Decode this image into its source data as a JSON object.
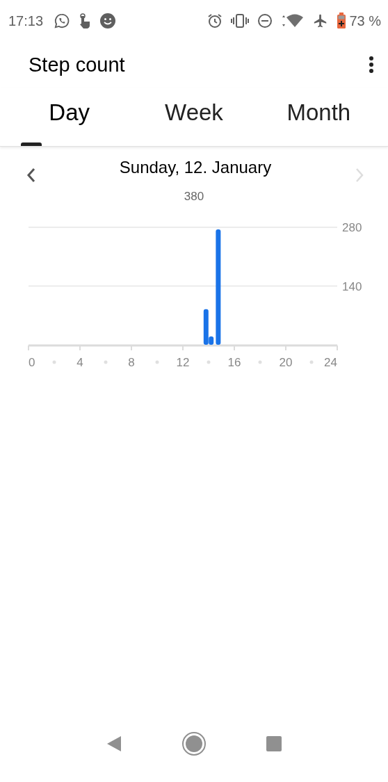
{
  "status_bar": {
    "time": "17:13",
    "battery": "73 %"
  },
  "app_bar": {
    "title": "Step count"
  },
  "tabs": [
    {
      "label": "Day",
      "selected": true
    },
    {
      "label": "Week",
      "selected": false
    },
    {
      "label": "Month",
      "selected": false
    }
  ],
  "day": {
    "date": "Sunday, 12. January",
    "total": "380",
    "next_disabled": true,
    "chart_data": {
      "type": "bar",
      "x": [
        13.8,
        14.2,
        14.75
      ],
      "values": [
        85,
        20,
        275
      ],
      "xlim": [
        0,
        24
      ],
      "ylim": [
        0,
        280
      ],
      "xticks": [
        0,
        4,
        8,
        12,
        16,
        20,
        24
      ],
      "yticks": [
        140,
        280
      ]
    }
  }
}
